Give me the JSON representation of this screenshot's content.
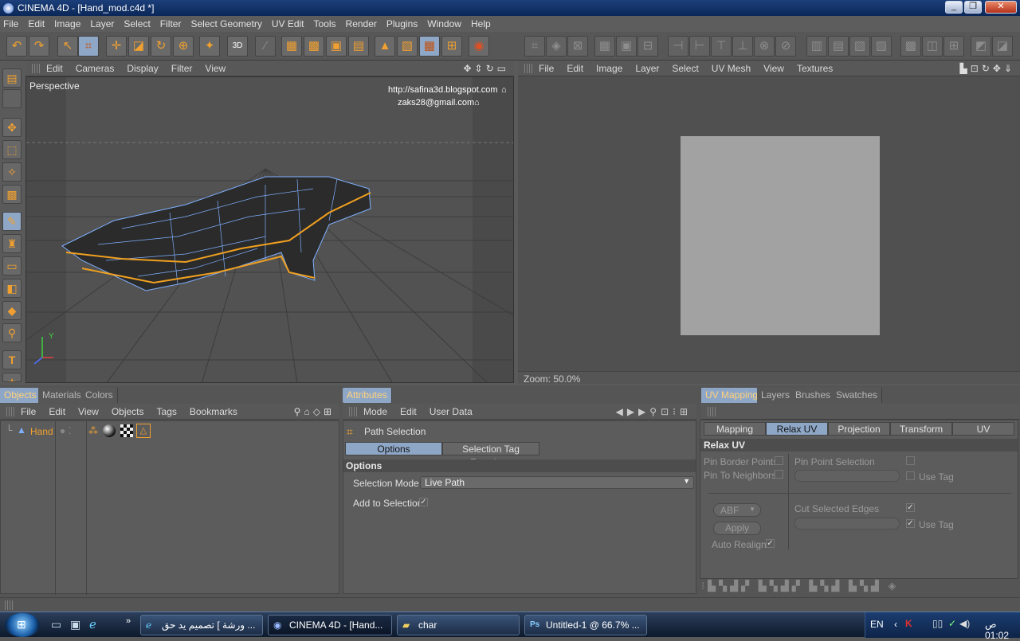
{
  "window": {
    "title": "CINEMA 4D - [Hand_mod.c4d *]"
  },
  "menubar": [
    "File",
    "Edit",
    "Image",
    "Layer",
    "Select",
    "Filter",
    "Select Geometry",
    "UV Edit",
    "Tools",
    "Render",
    "Plugins",
    "Window",
    "Help"
  ],
  "viewport": {
    "menu": [
      "Edit",
      "Cameras",
      "Display",
      "Filter",
      "View"
    ],
    "label": "Perspective",
    "watermark_url": "http://safina3d.blogspot.com",
    "watermark_email": "zaks28@gmail.com",
    "axis_y": "Y"
  },
  "uv_view": {
    "menu": [
      "File",
      "Edit",
      "Image",
      "Layer",
      "Select",
      "UV Mesh",
      "View",
      "Textures"
    ],
    "zoom_label": "Zoom: 50.0%"
  },
  "objects_panel": {
    "tabs": [
      "Objects",
      "Materials",
      "Colors"
    ],
    "menu": [
      "File",
      "Edit",
      "View",
      "Objects",
      "Tags",
      "Bookmarks"
    ],
    "rows": [
      {
        "name": "Hand"
      }
    ]
  },
  "attributes_panel": {
    "tab": "Attributes",
    "menu": [
      "Mode",
      "Edit",
      "User Data"
    ],
    "tool_name": "Path Selection",
    "subtabs": [
      "Options",
      "Selection Tag Functions"
    ],
    "section": "Options",
    "selection_mode_label": "Selection Mode",
    "selection_mode_value": "Live Path",
    "add_to_selection_label": "Add to Selection"
  },
  "uv_panel": {
    "tabs": [
      "UV Mapping",
      "Layers",
      "Brushes",
      "Swatches"
    ],
    "subtabs": [
      "Mapping",
      "Relax UV",
      "Projection",
      "Transform",
      "UV Commands"
    ],
    "section": "Relax UV",
    "pin_border": "Pin Border Points",
    "pin_neighbors": "Pin To Neighbors",
    "pin_point_selection": "Pin Point Selection",
    "use_tag_1": "Use Tag",
    "method": "ABF",
    "apply": "Apply",
    "auto_realign": "Auto Realign",
    "cut_selected_edges": "Cut Selected Edges",
    "use_tag_2": "Use Tag"
  },
  "taskbar": {
    "tasks": [
      "ورشة ] تصميم يد حق ...",
      "CINEMA 4D - [Hand...",
      "char",
      "Untitled-1 @ 66.7% ..."
    ],
    "lang": "EN",
    "clock": "ص 01:02"
  },
  "colors": {
    "accent": "#f0a030",
    "active_tab": "#8fa7c7",
    "wire": "#7fb0ff",
    "path": "#f0a020"
  }
}
